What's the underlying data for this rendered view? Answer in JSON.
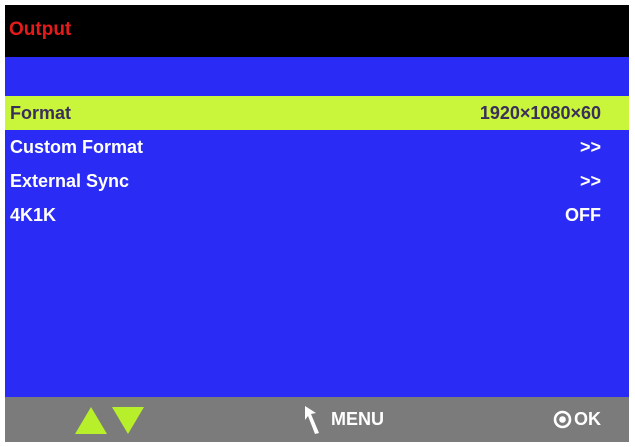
{
  "header": {
    "title": "Output"
  },
  "menu": {
    "items": [
      {
        "label": "Format",
        "value": "1920×1080×60"
      },
      {
        "label": "Custom Format",
        "value": ">>"
      },
      {
        "label": "External Sync",
        "value": ">>"
      },
      {
        "label": "4K1K",
        "value": "OFF"
      }
    ]
  },
  "footer": {
    "menu_label": "MENU",
    "ok_label": "OK",
    "icons": [
      "up-arrow-icon",
      "down-arrow-icon",
      "back-arrow-icon",
      "ok-circle-icon"
    ]
  },
  "colors": {
    "title": "#e51b1b",
    "background": "#2b2bf6",
    "highlight": "#c9f53b",
    "footer": "#7b7b7b",
    "arrows": "#b7f02a"
  }
}
